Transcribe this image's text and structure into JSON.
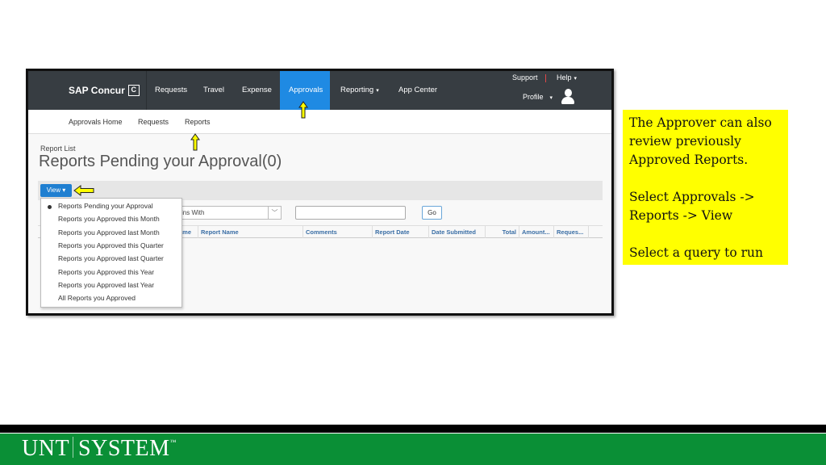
{
  "app": {
    "brand": "SAP Concur",
    "brand_icon": "C"
  },
  "topnav": {
    "items": [
      {
        "label": "Requests"
      },
      {
        "label": "Travel"
      },
      {
        "label": "Expense"
      },
      {
        "label": "Approvals",
        "active": true
      },
      {
        "label": "Reporting",
        "caret": "▾"
      },
      {
        "label": "App Center"
      }
    ],
    "support": "Support",
    "help": "Help",
    "profile": "Profile",
    "caret": "▾",
    "active_color": "#1f8ae3"
  },
  "subnav": {
    "items": [
      {
        "label": "Approvals Home"
      },
      {
        "label": "Requests"
      },
      {
        "label": "Reports"
      }
    ]
  },
  "main": {
    "breadcrumb": "Report List",
    "title": "Reports Pending your Approval(0)",
    "view_button": "View ▾",
    "filter_select": "ins With",
    "filter_chevron": "﹀",
    "search_value": "",
    "go_button": "Go",
    "columns": [
      {
        "label": "ame"
      },
      {
        "label": "Report Name"
      },
      {
        "label": "Comments"
      },
      {
        "label": "Report Date"
      },
      {
        "label": "Date Submitted"
      },
      {
        "label": "Total"
      },
      {
        "label": "Amount..."
      },
      {
        "label": "Reques..."
      }
    ]
  },
  "view_menu": {
    "items": [
      {
        "label": "Reports Pending your Approval",
        "selected": true
      },
      {
        "label": "Reports you Approved this Month"
      },
      {
        "label": "Reports you Approved last Month"
      },
      {
        "label": "Reports you Approved this Quarter"
      },
      {
        "label": "Reports you Approved last Quarter"
      },
      {
        "label": "Reports you Approved this Year"
      },
      {
        "label": "Reports you Approved last Year"
      },
      {
        "label": "All Reports you Approved"
      }
    ]
  },
  "callout": {
    "paragraphs": [
      "The Approver can also review previously Approved Reports.",
      "Select Approvals -> Reports -> View",
      "Select a query to run"
    ],
    "background": "#ffff00"
  },
  "footer": {
    "logo_left": "UNT",
    "logo_right": "SYSTEM",
    "trademark": "™",
    "color": "#0a8f36"
  }
}
